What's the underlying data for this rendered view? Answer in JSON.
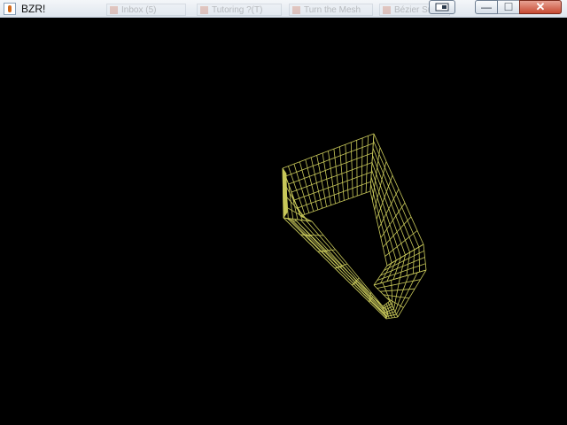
{
  "window": {
    "title": "BZR!",
    "background_tabs": [
      "Inbox (5)",
      "Tutoring ?(T)",
      "Turn the Mesh",
      "Bézier Surfaces"
    ]
  },
  "controls": {
    "special_icon": "window-switch-icon",
    "minimize_symbol": "—",
    "maximize_symbol": "☐",
    "close_symbol": "✕"
  },
  "render": {
    "mesh_color": "#c8c85a",
    "background_color": "#000000"
  }
}
